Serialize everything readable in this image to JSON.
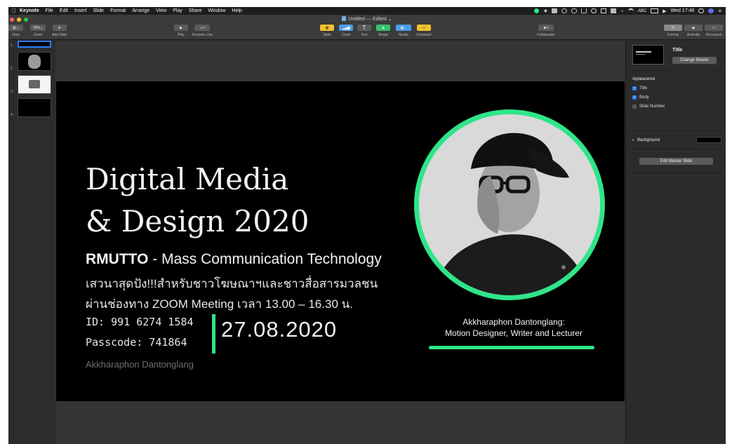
{
  "menubar": {
    "app": "Keynote",
    "items": [
      "File",
      "Edit",
      "Insert",
      "Slide",
      "Format",
      "Arrange",
      "View",
      "Play",
      "Share",
      "Window",
      "Help"
    ],
    "input_indicator": "ABC",
    "clock": "Wed 17:46"
  },
  "window": {
    "doc_title": "Untitled — Edited ⌄"
  },
  "toolbar": {
    "view_label": "View",
    "zoom_value": "79%",
    "zoom_label": "Zoom",
    "add_slide_label": "Add Slide",
    "play_label": "Play",
    "keynote_live_label": "Keynote Live",
    "table_label": "Table",
    "chart_label": "Chart",
    "text_label": "Text",
    "shape_label": "Shape",
    "media_label": "Media",
    "comment_label": "Comment",
    "collaborate_label": "Collaborate",
    "format_label": "Format",
    "animate_label": "Animate",
    "document_label": "Document"
  },
  "navigator": {
    "slide_numbers": [
      "1",
      "2",
      "3",
      "4"
    ]
  },
  "slide": {
    "title_line1": "Digital Media",
    "title_line2": "& Design 2020",
    "org_bold": "RMUTTO",
    "org_rest": " - Mass Communication Technology",
    "thai_line1": "เสวนาสุดปัง!!!สำหรับชาวโฆษณาฯและชาวสื่อสารมวลชน",
    "thai_line2": "ผ่านช่องทาง ZOOM Meeting เวลา 13.00 – 16.30 น.",
    "meeting_id": "ID: 991 6274 1584",
    "passcode": "Passcode: 741864",
    "date": "27.08.2020",
    "author_small": "Akkharaphon Dantonglang",
    "caption_line1": "Akkharaphon Dantonglang:",
    "caption_line2": "Motion Designer, Writer and Lecturer",
    "accent_color": "#2ee589"
  },
  "inspector": {
    "master_title": "Title",
    "change_master": "Change Master",
    "appearance_heading": "Appearance",
    "checkbox_title": "Title",
    "checkbox_body": "Body",
    "checkbox_slide_number": "Slide Number",
    "background_label": "Background",
    "edit_master": "Edit Master Slide"
  }
}
